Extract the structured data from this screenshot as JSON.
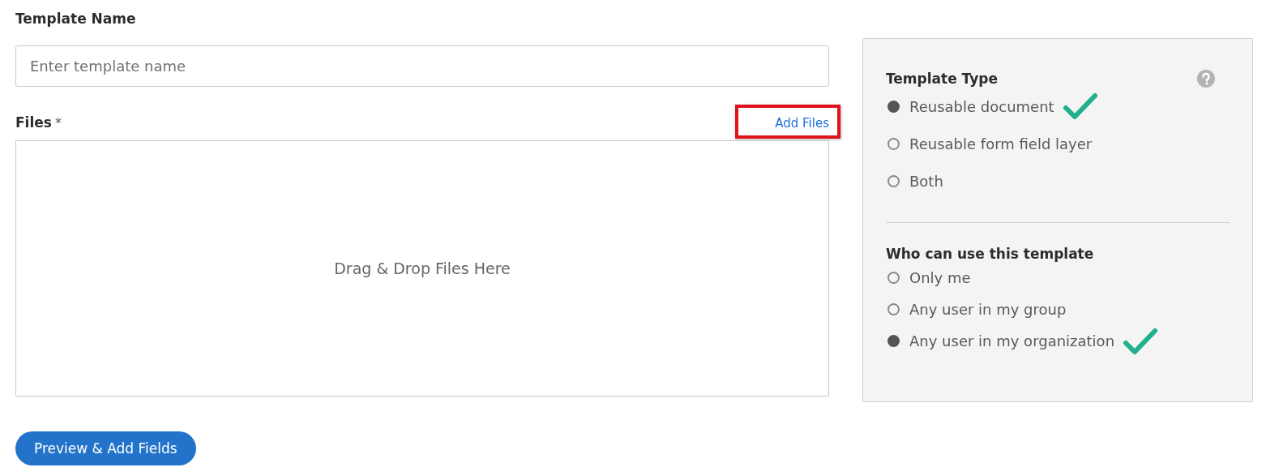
{
  "template_name": {
    "label": "Template Name",
    "placeholder": "Enter template name"
  },
  "files": {
    "label": "Files",
    "required_mark": "*",
    "add_link": {
      "label": "Add Files",
      "highlighted": true
    },
    "drop_zone": "Drag & Drop Files Here"
  },
  "template_type": {
    "title": "Template Type",
    "options": [
      {
        "label": "Reusable document",
        "selected": true,
        "check_mark": true
      },
      {
        "label": "Reusable form field layer",
        "selected": false,
        "check_mark": false
      },
      {
        "label": "Both",
        "selected": false,
        "check_mark": false
      }
    ]
  },
  "who_can_use": {
    "title": "Who can use this template",
    "options": [
      {
        "label": "Only me",
        "selected": false,
        "check_mark": false
      },
      {
        "label": "Any user in my group",
        "selected": false,
        "check_mark": false
      },
      {
        "label": "Any user in my organization",
        "selected": true,
        "check_mark": true
      }
    ]
  },
  "primary_button": "Preview & Add Fields"
}
